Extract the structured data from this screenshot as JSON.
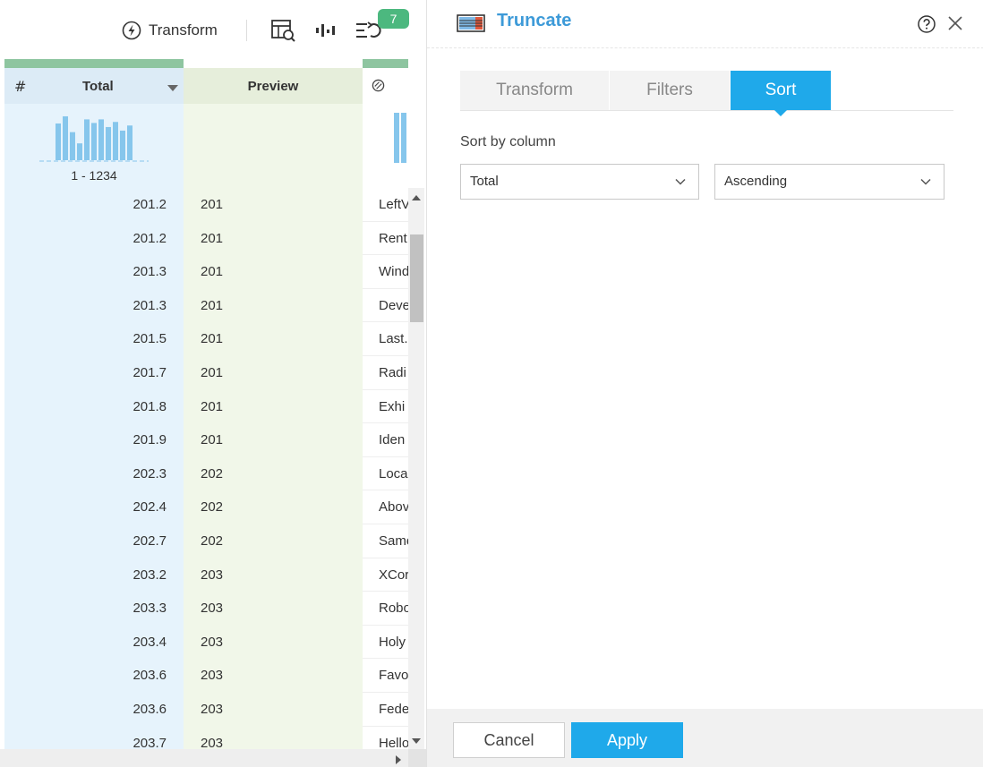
{
  "toolbar": {
    "transform_label": "Transform",
    "badge_count": "7"
  },
  "grid": {
    "columns": [
      {
        "label": "Total",
        "type_icon": "hash-icon"
      },
      {
        "label": "Preview"
      },
      {
        "label": "",
        "type_icon": "text-type-icon"
      }
    ],
    "total_range": "1 - 1234",
    "histogram_values": [
      0.72,
      0.86,
      0.55,
      0.33,
      0.8,
      0.73,
      0.8,
      0.65,
      0.75,
      0.58,
      0.68
    ],
    "rows": [
      {
        "total": "201.2",
        "preview": "201",
        "text": "LeftV"
      },
      {
        "total": "201.2",
        "preview": "201",
        "text": "Rent"
      },
      {
        "total": "201.3",
        "preview": "201",
        "text": "Wind"
      },
      {
        "total": "201.3",
        "preview": "201",
        "text": "Deve"
      },
      {
        "total": "201.5",
        "preview": "201",
        "text": "Last."
      },
      {
        "total": "201.7",
        "preview": "201",
        "text": "Radi"
      },
      {
        "total": "201.8",
        "preview": "201",
        "text": "Exhi"
      },
      {
        "total": "201.9",
        "preview": "201",
        "text": "Iden"
      },
      {
        "total": "202.3",
        "preview": "202",
        "text": "Loca"
      },
      {
        "total": "202.4",
        "preview": "202",
        "text": "Abov"
      },
      {
        "total": "202.7",
        "preview": "202",
        "text": "Same"
      },
      {
        "total": "203.2",
        "preview": "203",
        "text": "XCor"
      },
      {
        "total": "203.3",
        "preview": "203",
        "text": "Robo"
      },
      {
        "total": "203.4",
        "preview": "203",
        "text": "Holy"
      },
      {
        "total": "203.6",
        "preview": "203",
        "text": "Favo"
      },
      {
        "total": "203.6",
        "preview": "203",
        "text": "Fede"
      },
      {
        "total": "203.7",
        "preview": "203",
        "text": "Hello"
      }
    ]
  },
  "panel": {
    "title": "Truncate",
    "tabs": [
      {
        "label": "Transform",
        "active": false
      },
      {
        "label": "Filters",
        "active": false
      },
      {
        "label": "Sort",
        "active": true
      }
    ],
    "sort_by_label": "Sort by column",
    "sort_column": "Total",
    "sort_order": "Ascending",
    "cancel_label": "Cancel",
    "apply_label": "Apply"
  },
  "colors": {
    "accent": "#1fa9ea",
    "title": "#3d9ad8",
    "total_col_bg": "#e6f3fc",
    "preview_col_bg": "#f1f7e9",
    "column_bar": "#8ec5a0",
    "badge": "#4cb87f",
    "histogram": "#86c6ec"
  }
}
